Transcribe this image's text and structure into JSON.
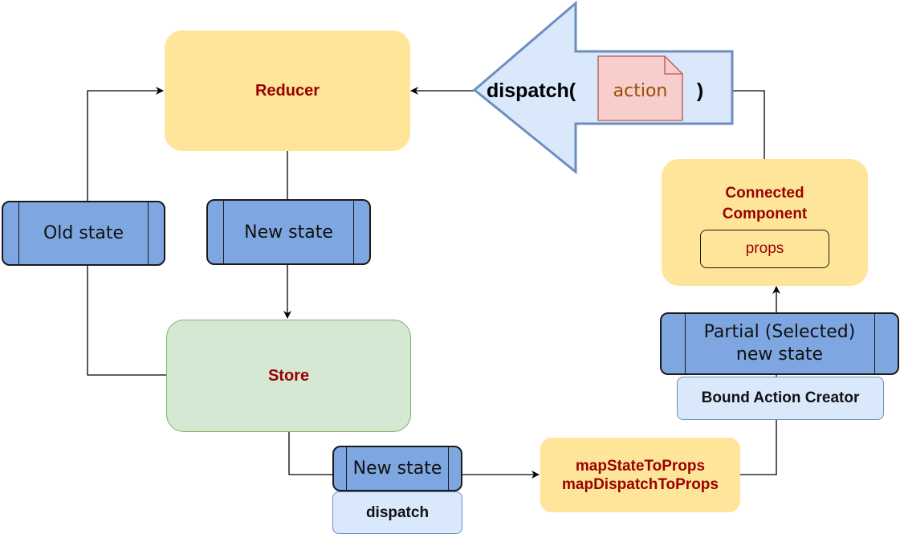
{
  "reducer": {
    "label": "Reducer"
  },
  "store": {
    "label": "Store"
  },
  "old_state": {
    "label": "Old state"
  },
  "new_state_top": {
    "label": "New state"
  },
  "new_state_bottom": {
    "label": "New state"
  },
  "dispatch_box": {
    "label": "dispatch"
  },
  "map_box": {
    "line1": "mapStateToProps",
    "line2": "mapDispatchToProps"
  },
  "partial_state": {
    "line1": "Partial (Selected)",
    "line2": "new state"
  },
  "bound_action_creator": {
    "label": "Bound Action Creator"
  },
  "connected_component": {
    "line1": "Connected",
    "line2": "Component",
    "props_label": "props"
  },
  "dispatch_arrow": {
    "prefix": "dispatch(",
    "suffix": ")",
    "action_label": "action"
  },
  "colors": {
    "title_red": "#990000",
    "yellow": "#ffe599",
    "green": "#d5e8d4",
    "state_blue": "#7ea6e0",
    "light_blue": "#dae8fc",
    "note_pink": "#f8cecc"
  }
}
